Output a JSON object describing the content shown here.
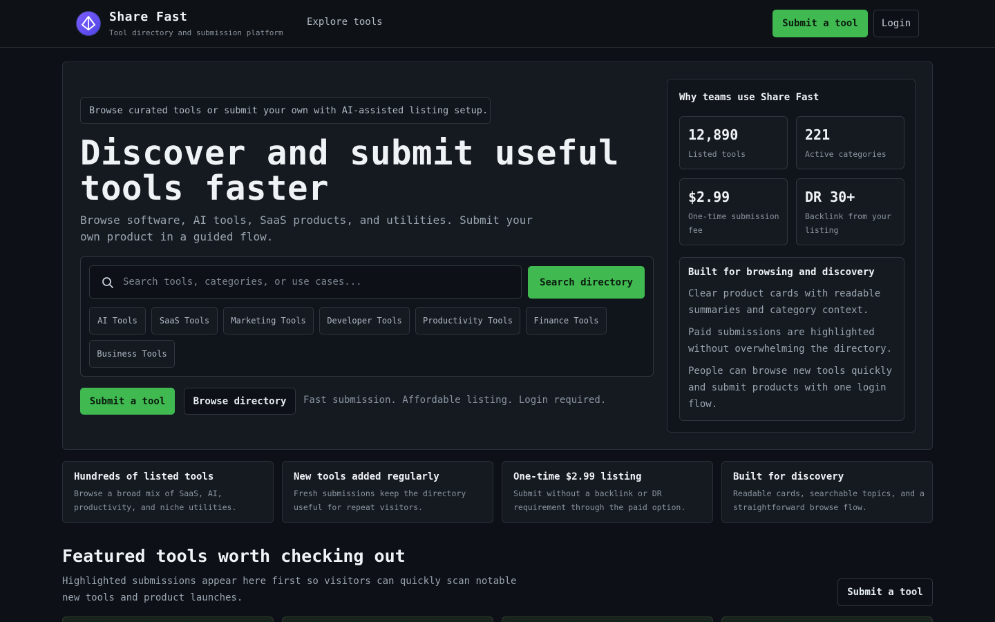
{
  "nav": {
    "brand_name": "Share Fast",
    "brand_subtitle": "Tool directory and submission platform",
    "explore_link": "Explore tools",
    "submit_button": "Submit a tool",
    "login_button": "Login",
    "logo_icon": "diamond-logo-icon"
  },
  "hero": {
    "intro_pill": "Browse curated tools or submit your own with AI-assisted listing setup.",
    "title": "Discover and submit useful tools faster",
    "description": "Browse software, AI tools, SaaS products, and utilities. Submit your own product in a guided flow.",
    "search": {
      "placeholder": "Search tools, categories, or use cases...",
      "button": "Search directory",
      "icon": "search-icon"
    },
    "categories": [
      "AI Tools",
      "SaaS Tools",
      "Marketing Tools",
      "Developer Tools",
      "Productivity Tools",
      "Finance Tools",
      "Business Tools"
    ],
    "submit_button": "Submit a tool",
    "browse_button": "Browse directory",
    "note": "Fast submission. Affordable listing. Login required."
  },
  "why": {
    "title": "Why teams use Share Fast",
    "stats": [
      {
        "value": "12,890",
        "label": "Listed tools"
      },
      {
        "value": "221",
        "label": "Active categories"
      },
      {
        "value": "$2.99",
        "label": "One-time submission fee"
      },
      {
        "value": "DR 30+",
        "label": "Backlink from your listing"
      }
    ],
    "built": {
      "title": "Built for browsing and discovery",
      "paragraphs": [
        "Clear product cards with readable summaries and category context.",
        "Paid submissions are highlighted without overwhelming the directory.",
        "People can browse new tools quickly and submit products with one login flow."
      ]
    }
  },
  "features": [
    {
      "title": "Hundreds of listed tools",
      "desc": "Browse a broad mix of SaaS, AI, productivity, and niche utilities."
    },
    {
      "title": "New tools added regularly",
      "desc": "Fresh submissions keep the directory useful for repeat visitors."
    },
    {
      "title": "One-time $2.99 listing",
      "desc": "Submit without a backlink or DR requirement through the paid option."
    },
    {
      "title": "Built for discovery",
      "desc": "Readable cards, searchable topics, and a straightforward browse flow."
    }
  ],
  "featured": {
    "heading": "Featured tools worth checking out",
    "subtitle": "Highlighted submissions appear here first so visitors can quickly scan notable new tools and product launches.",
    "submit_button": "Submit a tool"
  },
  "colors": {
    "background": "#0d1117",
    "panel": "#151a21",
    "accent_green": "#3fb950",
    "logo_purple": "#7c5cff"
  }
}
